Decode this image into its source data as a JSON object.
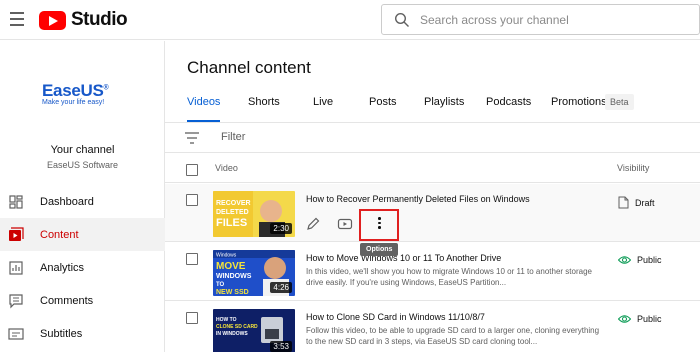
{
  "app": {
    "logo_text": "Studio"
  },
  "search": {
    "placeholder": "Search across your channel"
  },
  "sidebar": {
    "brand": {
      "name": "EaseUS",
      "reg": "®",
      "tagline": "Make your life easy!"
    },
    "channel_title": "Your channel",
    "channel_name": "EaseUS Software",
    "items": [
      {
        "label": "Dashboard",
        "icon": "dashboard-icon",
        "active": false
      },
      {
        "label": "Content",
        "icon": "content-icon",
        "active": true
      },
      {
        "label": "Analytics",
        "icon": "analytics-icon",
        "active": false
      },
      {
        "label": "Comments",
        "icon": "comments-icon",
        "active": false
      },
      {
        "label": "Subtitles",
        "icon": "subtitles-icon",
        "active": false
      }
    ]
  },
  "main": {
    "title": "Channel content",
    "tabs": [
      "Videos",
      "Shorts",
      "Live",
      "Posts",
      "Playlists",
      "Podcasts",
      "Promotions"
    ],
    "beta_badge": "Beta",
    "filter_label": "Filter",
    "columns": {
      "video": "Video",
      "visibility": "Visibility"
    },
    "rows": [
      {
        "title": "How to Recover Permanently Deleted Files on Windows",
        "description": "",
        "duration": "2:30",
        "visibility": "Draft",
        "thumb_text": [
          "RECOVER",
          "DELETED",
          "FILES"
        ]
      },
      {
        "title": "How to Move Windows 10 or 11 To Another Drive",
        "description": "In this video, we'll show you how to migrate Windows 10 or 11 to another storage drive easily. If you're using Windows, EaseUS Partition...",
        "duration": "4:26",
        "visibility": "Public",
        "thumb_text": [
          "Windows",
          "MOVE",
          "WINDOWS",
          "TO",
          "NEW SSD"
        ]
      },
      {
        "title": "How to Clone SD Card in Windows 11/10/8/7",
        "description": "Follow this video, to be able to upgrade SD card to a larger one, cloning everything to the new SD card in 3 steps, via EaseUS SD card cloning tool...",
        "duration": "3:53",
        "visibility": "Public",
        "thumb_text": [
          "HOW TO",
          "CLONE SD CARD",
          "IN WINDOWS"
        ]
      }
    ],
    "tooltip": "Options"
  },
  "colors": {
    "accent": "#065fd4",
    "brand_red": "#ff0000",
    "active_nav": "#cc0000",
    "public_green": "#0f9d58"
  }
}
